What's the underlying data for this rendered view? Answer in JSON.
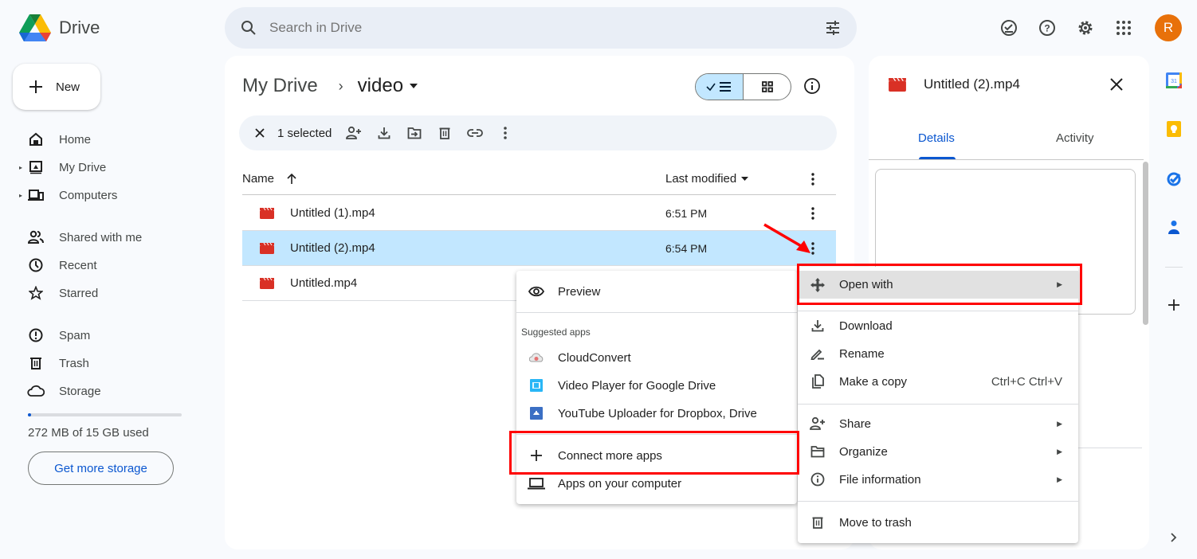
{
  "app": {
    "name": "Drive"
  },
  "search": {
    "placeholder": "Search in Drive"
  },
  "account": {
    "initial": "R",
    "color": "#e8710a"
  },
  "sidebar": {
    "new_label": "New",
    "items": [
      {
        "label": "Home",
        "icon": "home-icon"
      },
      {
        "label": "My Drive",
        "icon": "my-drive-icon",
        "expandable": true
      },
      {
        "label": "Computers",
        "icon": "computers-icon",
        "expandable": true
      },
      {
        "label": "Shared with me",
        "icon": "shared-icon"
      },
      {
        "label": "Recent",
        "icon": "clock-icon"
      },
      {
        "label": "Starred",
        "icon": "star-icon"
      },
      {
        "label": "Spam",
        "icon": "spam-icon"
      },
      {
        "label": "Trash",
        "icon": "trash-icon"
      },
      {
        "label": "Storage",
        "icon": "cloud-icon"
      }
    ],
    "storage": {
      "text": "272 MB of 15 GB used",
      "used_fraction": 0.018,
      "button": "Get more storage"
    }
  },
  "breadcrumb": {
    "root": "My Drive",
    "separator": "›",
    "current": "video"
  },
  "selection_bar": {
    "count_label": "1 selected"
  },
  "file_list": {
    "columns": {
      "name": "Name",
      "modified": "Last modified"
    },
    "rows": [
      {
        "name": "Untitled (1).mp4",
        "modified": "6:51 PM",
        "selected": false
      },
      {
        "name": "Untitled (2).mp4",
        "modified": "6:54 PM",
        "selected": true
      },
      {
        "name": "Untitled.mp4",
        "modified": "",
        "selected": false
      }
    ]
  },
  "details_panel": {
    "file_name": "Untitled (2).mp4",
    "tabs": [
      "Details",
      "Activity"
    ],
    "active_tab": "Details"
  },
  "context_menu": {
    "items": [
      {
        "label": "Open with",
        "icon": "open-with-icon",
        "submenu": true,
        "highlighted": true
      },
      {
        "label": "Download",
        "icon": "download-icon"
      },
      {
        "label": "Rename",
        "icon": "rename-icon"
      },
      {
        "label": "Make a copy",
        "icon": "copy-icon",
        "shortcut": "Ctrl+C Ctrl+V"
      },
      {
        "label": "Share",
        "icon": "share-icon",
        "submenu": true
      },
      {
        "label": "Organize",
        "icon": "organize-icon",
        "submenu": true
      },
      {
        "label": "File information",
        "icon": "info-icon",
        "submenu": true
      },
      {
        "label": "Move to trash",
        "icon": "trash-icon"
      }
    ]
  },
  "open_with_menu": {
    "preview": "Preview",
    "suggested_heading": "Suggested apps",
    "apps": [
      "CloudConvert",
      "Video Player for Google Drive",
      "YouTube Uploader for Dropbox, Drive"
    ],
    "connect": "Connect more apps",
    "computer": "Apps on your computer"
  },
  "annotations": {
    "highlight_color": "#ff0000"
  },
  "rail": {
    "calendar_day": "31"
  }
}
